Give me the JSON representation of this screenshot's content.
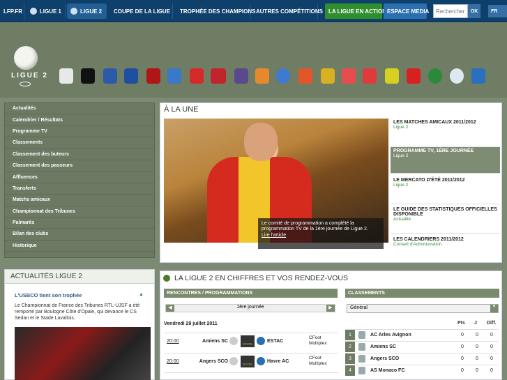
{
  "topnav": {
    "site": "LFP.FR",
    "items": [
      "LIGUE 1",
      "LIGUE 2",
      "COUPE DE LA LIGUE",
      "TROPHÉE DES CHAMPIONS",
      "AUTRES COMPÉTITIONS"
    ],
    "special": [
      "LA LIGUE EN ACTION",
      "ESPACE MEDIA"
    ],
    "search_placeholder": "Rechercher",
    "search_button": "OK",
    "lang": "FR"
  },
  "header": {
    "logo_text": "LIGUE 2"
  },
  "menu": [
    "Actualités",
    "Calendrier / Résultats",
    "Programme TV",
    "Classements",
    "Classement des buteurs",
    "Classement des passeurs",
    "Affluences",
    "Transferts",
    "Matchs amicaux",
    "Championnat des Tribunes",
    "Palmarès",
    "Bilan des clubs",
    "Historique"
  ],
  "actu": {
    "title": "ACTUALITÉS LIGUE 2",
    "headline": "L'USBCO tient son trophée",
    "body": "Le Championnat de France des Tribunes RTL-UJSF a été remporté par Boulogne Côte d'Opale, qui devance le CS Sedan et le Stade Lavallois."
  },
  "une": {
    "title": "À LA UNE",
    "caption": "Le comité de programmation a complété la programmation TV de la 1ère journée de Ligue 2.",
    "caption_link": "Lire l'article",
    "items": [
      {
        "title": "LES MATCHES AMICAUX 2011/2012",
        "cat": "Ligue 2"
      },
      {
        "title": "PROGRAMME TV, 1ÈRE JOURNÉE",
        "cat": "Ligue 2"
      },
      {
        "title": "LE MERCATO D'ÉTÉ 2011/2012",
        "cat": "Ligue 2"
      },
      {
        "title": "LE GUIDE DES STATISTIQUES OFFICIELLES DISPONIBLE",
        "cat": "Actualité"
      },
      {
        "title": "LES CALENDRIERS 2011/2012",
        "cat": "Conseil d'Administration"
      }
    ]
  },
  "chiffres": {
    "title": "LA LIGUE 2 EN CHIFFRES ET VOS RENDEZ-VOUS",
    "rencontres_head": "RENCONTRES / PROGRAMMATIONS",
    "journee": "1ère journée",
    "date": "Vendredi 29 juillet 2011",
    "stats_label": "STATS",
    "matches": [
      {
        "time": "20:00",
        "home": "Amiens SC",
        "away": "ESTAC",
        "tv": "CFoot Multiplex"
      },
      {
        "time": "20:00",
        "home": "Angers SCO",
        "away": "Havre AC",
        "tv": "CFoot Multiplex"
      }
    ],
    "classements_head": "CLASSEMENTS",
    "classement_select": "Général",
    "cols": [
      "Pts",
      "J",
      "Diff."
    ],
    "rows": [
      {
        "rank": "1",
        "club": "AC Arles Avignon",
        "pts": "0",
        "j": "0",
        "diff": "0"
      },
      {
        "rank": "2",
        "club": "Amiens SC",
        "pts": "0",
        "j": "0",
        "diff": "0"
      },
      {
        "rank": "3",
        "club": "Angers SCO",
        "pts": "0",
        "j": "0",
        "diff": "0"
      },
      {
        "rank": "4",
        "club": "AS Monaco FC",
        "pts": "0",
        "j": "0",
        "diff": "0"
      }
    ]
  },
  "colors": {
    "nav": "#0f3f6b",
    "band": "#7d8a73",
    "accent_green": "#3a8a3a"
  }
}
